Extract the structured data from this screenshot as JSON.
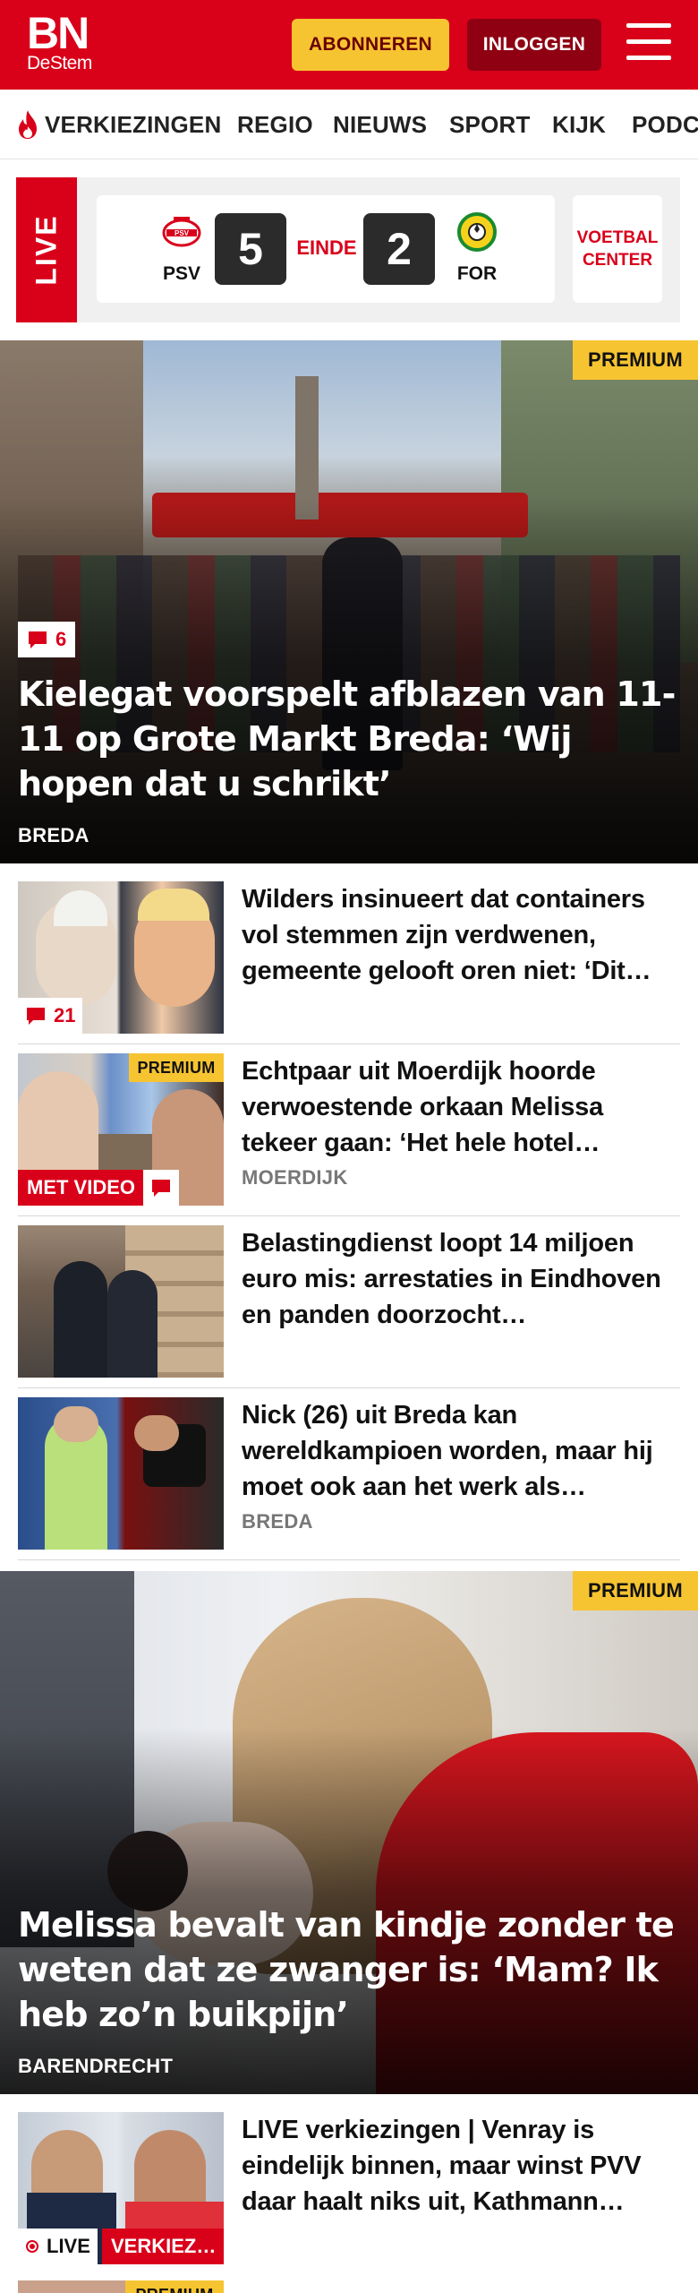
{
  "header": {
    "logo_main": "BN",
    "logo_sub": "DeStem",
    "subscribe_label": "ABONNEREN",
    "login_label": "INLOGGEN"
  },
  "nav": {
    "items": [
      "VERKIEZINGEN",
      "REGIO",
      "NIEUWS",
      "SPORT",
      "KIJK",
      "PODC"
    ]
  },
  "live": {
    "label": "LIVE",
    "home_team": "PSV",
    "home_score": "5",
    "status": "EINDE",
    "away_score": "2",
    "away_team": "FOR",
    "center_label_1": "VOETBAL",
    "center_label_2": "CENTER"
  },
  "hero1": {
    "premium": "PREMIUM",
    "comments": "6",
    "title": "Kielegat voorspelt afblazen van 11-11 op Grote Markt Breda: ‘Wij hopen dat u schrikt’",
    "category": "BREDA"
  },
  "articles": [
    {
      "title": "Wilders insinueert dat containers vol stemmen zijn verdwenen, gemeente gelooft oren niet: ‘Dit…",
      "category": "",
      "comments": "21"
    },
    {
      "title": "Echtpaar uit Moerdijk hoorde verwoestende orkaan Melissa tekeer gaan: ‘Het hele hotel…",
      "category": "MOERDIJK",
      "premium": "PREMIUM",
      "video": "MET VIDEO"
    },
    {
      "title": "Belastingdienst loopt 14 miljoen euro mis: arrestaties in Eindhoven en panden doorzocht…",
      "category": ""
    },
    {
      "title": "Nick (26) uit Breda kan wereldkampioen worden, maar hij moet ook aan het werk als…",
      "category": "BREDA"
    }
  ],
  "hero2": {
    "premium": "PREMIUM",
    "title": "Melissa bevalt van kindje zonder te weten dat ze zwanger is: ‘Mam? Ik heb zo’n buikpijn’",
    "category": "BARENDRECHT"
  },
  "article_live": {
    "title": "LIVE verkiezingen | Venray is eindelijk binnen, maar winst PVV daar haalt niks uit, Kathmann…",
    "live_tag": "LIVE",
    "topic_tag": "VERKIEZ…"
  },
  "article_partial": {
    "premium": "PREMIUM"
  },
  "colors": {
    "brand_red": "#d9001a",
    "premium_yellow": "#f7c431",
    "dark_red": "#8e0012"
  }
}
